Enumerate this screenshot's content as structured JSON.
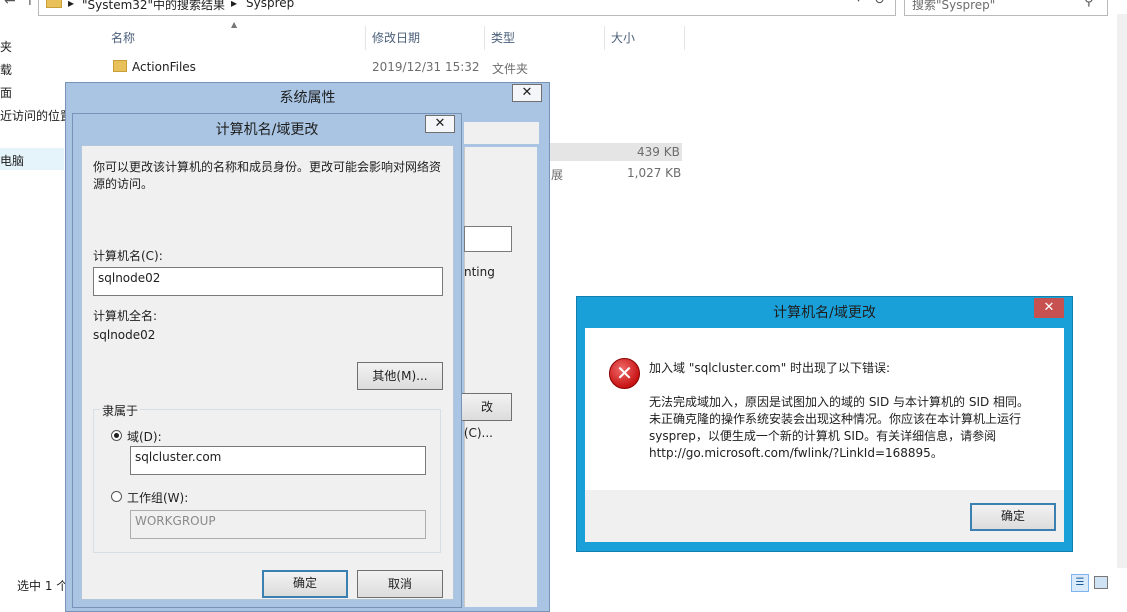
{
  "explorer": {
    "back_icon": "back-icon",
    "breadcrumb_search": "\"System32\"中的搜索结果",
    "breadcrumb_sep": "▸",
    "breadcrumb_current": "Sysprep",
    "search_placeholder": "搜索\"Sysprep\"",
    "nav_items": [
      "夹",
      "载",
      "面",
      "近访问的位置",
      "电脑"
    ],
    "columns": {
      "name": "名称",
      "date": "修改日期",
      "type": "类型",
      "size": "大小"
    },
    "rows": [
      {
        "name": "ActionFiles",
        "date": "2019/12/31 15:32",
        "type": "文件夹",
        "size": ""
      }
    ],
    "partial_sizes": [
      "439 KB",
      "1,027 KB"
    ],
    "partial_type": "展",
    "status": "选中 1 个"
  },
  "system_properties": {
    "title": "系统属性",
    "close": "✕",
    "partial_text": "nting",
    "partial_button": "改(C)..."
  },
  "computer_name_dialog": {
    "title": "计算机名/域更改",
    "close": "✕",
    "description": "你可以更改该计算机的名称和成员身份。更改可能会影响对网络资源的访问。",
    "computer_name_label": "计算机名(C):",
    "computer_name_value": "sqlnode02",
    "full_name_label": "计算机全名:",
    "full_name_value": "sqlnode02",
    "more_button": "其他(M)...",
    "member_of_label": "隶属于",
    "domain_label": "域(D):",
    "domain_value": "sqlcluster.com",
    "workgroup_label": "工作组(W):",
    "workgroup_value": "WORKGROUP",
    "ok_button": "确定",
    "cancel_button": "取消"
  },
  "error_dialog": {
    "title": "计算机名/域更改",
    "close": "✕",
    "heading": "加入域 \"sqlcluster.com\" 时出现了以下错误:",
    "line1": "无法完成域加入，原因是试图加入的域的 SID 与本计算机的 SID 相同。",
    "line2": "未正确克隆的操作系统安装会出现这种情况。你应该在本计算机上运行",
    "line3": "sysprep，以便生成一个新的计算机 SID。有关详细信息，请参阅",
    "line4": "http://go.microsoft.com/fwlink/?LinkId=168895。",
    "ok_button": "确定"
  }
}
